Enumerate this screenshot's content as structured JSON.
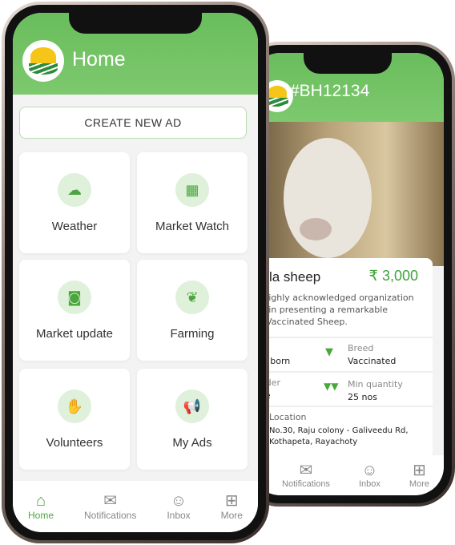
{
  "colors": {
    "accent": "#4aa63d",
    "header": "#6cbf5f",
    "price": "#3fa33a"
  },
  "back_phone": {
    "title": "#BH12134",
    "listing": {
      "name": "kala sheep",
      "price": "₹ 3,000",
      "description": [
        "e highly acknowledged organization",
        "ed in presenting a remarkable",
        "of Vaccinated Sheep."
      ],
      "fields": [
        {
          "label": "ge",
          "value": "ew born"
        },
        {
          "label": "Breed",
          "value": "Vaccinated",
          "icon": "cow-icon"
        },
        {
          "label": "ender",
          "value": "lale"
        },
        {
          "label": "Min quantity",
          "value": "25 nos",
          "icon": "cows-icon"
        }
      ],
      "location_label": "Location",
      "location": [
        "No.30, Raju colony - Galiveedu Rd,",
        "Kothapeta, Rayachoty"
      ]
    },
    "nav": [
      {
        "label": "Notifications",
        "icon": "envelope-icon"
      },
      {
        "label": "Inbox",
        "icon": "chat-icon"
      },
      {
        "label": "More",
        "icon": "grid-icon"
      }
    ]
  },
  "front_phone": {
    "title": "Home",
    "create_button": "CREATE NEW AD",
    "tiles": [
      {
        "label": "Weather",
        "icon": "weather-icon"
      },
      {
        "label": "Market Watch",
        "icon": "building-icon"
      },
      {
        "label": "Market update",
        "icon": "headset-icon"
      },
      {
        "label": "Farming",
        "icon": "plant-hand-icon"
      },
      {
        "label": "Volunteers",
        "icon": "raised-hands-icon"
      },
      {
        "label": "My Ads",
        "icon": "megaphone-icon"
      }
    ],
    "nav": [
      {
        "label": "Home",
        "icon": "home-icon",
        "active": true
      },
      {
        "label": "Notifications",
        "icon": "envelope-icon"
      },
      {
        "label": "Inbox",
        "icon": "chat-icon"
      },
      {
        "label": "More",
        "icon": "grid-icon"
      }
    ]
  }
}
